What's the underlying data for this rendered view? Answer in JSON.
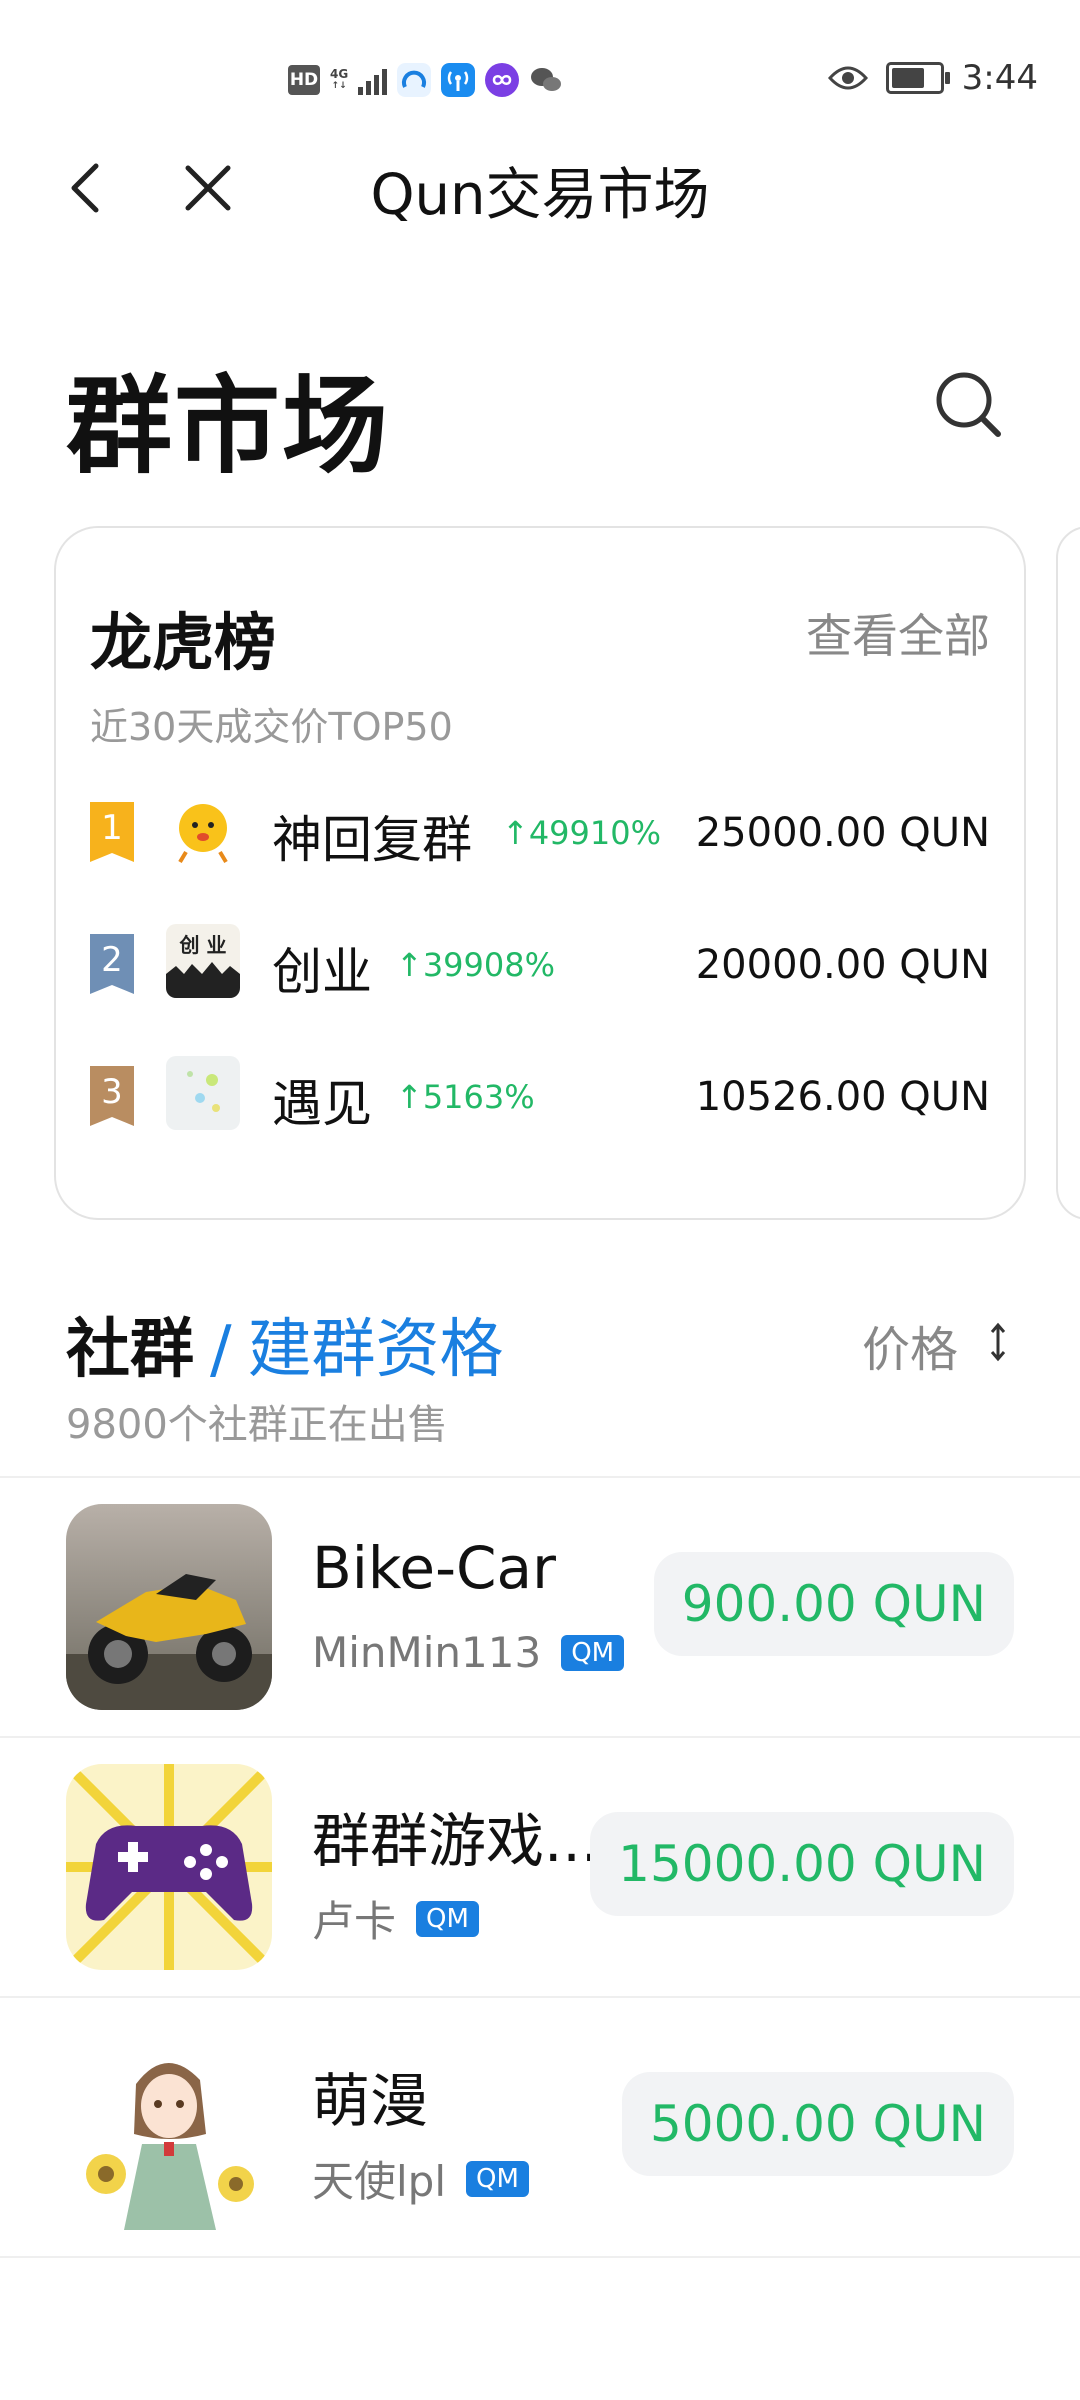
{
  "status_bar": {
    "hd": "HD",
    "network": "4G",
    "time": "3:44"
  },
  "nav": {
    "title": "Qun交易市场"
  },
  "page": {
    "title": "群市场"
  },
  "ranking": {
    "title": "龙虎榜",
    "view_all": "查看全部",
    "subtitle": "近30天成交价TOP50",
    "rows": [
      {
        "rank": "1",
        "name": "神回复群",
        "change": "↑49910%",
        "price": "25000.00 QUN",
        "badge_color": "#f7b21c"
      },
      {
        "rank": "2",
        "name": "创业",
        "change": "↑39908%",
        "price": "20000.00 QUN",
        "badge_color": "#6f8fb5"
      },
      {
        "rank": "3",
        "name": "遇见",
        "change": "↑5163%",
        "price": "10526.00 QUN",
        "badge_color": "#b98d61"
      }
    ]
  },
  "section": {
    "title": "社群",
    "slash": "/",
    "alt_title": "建群资格",
    "sort_label": "价格",
    "count_text": "9800个社群正在出售"
  },
  "listings": [
    {
      "name": "Bike-Car",
      "owner": "MinMin113",
      "tag": "QM",
      "price": "900.00 QUN"
    },
    {
      "name": "群群游戏...",
      "owner": "卢卡",
      "tag": "QM",
      "price": "15000.00 QUN"
    },
    {
      "name": "萌漫",
      "owner": "天使lpl",
      "tag": "QM",
      "price": "5000.00 QUN"
    }
  ],
  "colors": {
    "accent_blue": "#1a7fe0",
    "price_green": "#22b866"
  }
}
